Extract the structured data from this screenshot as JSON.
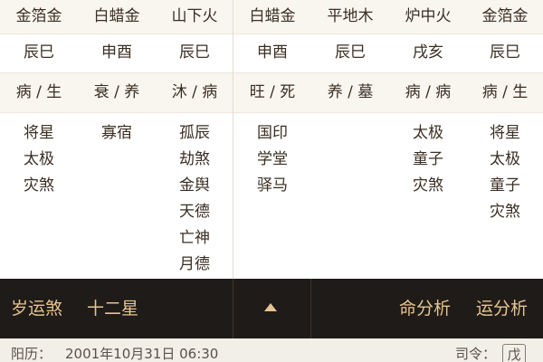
{
  "columns": [
    {
      "nayin": "金箔金",
      "kongwang": "辰巳",
      "state": "病 / 生",
      "stars": [
        "将星",
        "太极",
        "灾煞"
      ]
    },
    {
      "nayin": "白蜡金",
      "kongwang": "申酉",
      "state": "衰 / 养",
      "stars": [
        "寡宿"
      ]
    },
    {
      "nayin": "山下火",
      "kongwang": "辰巳",
      "state": "沐 / 病",
      "stars": [
        "孤辰",
        "劫煞",
        "金舆",
        "天德",
        "亡神",
        "月德"
      ]
    },
    {
      "nayin": "白蜡金",
      "kongwang": "申酉",
      "state": "旺 / 死",
      "stars": [
        "国印",
        "学堂",
        "驿马"
      ]
    },
    {
      "nayin": "平地木",
      "kongwang": "辰巳",
      "state": "养 / 墓",
      "stars": []
    },
    {
      "nayin": "炉中火",
      "kongwang": "戌亥",
      "state": "病 / 病",
      "stars": [
        "太极",
        "童子",
        "灾煞"
      ]
    },
    {
      "nayin": "金箔金",
      "kongwang": "辰巳",
      "state": "病 / 生",
      "stars": [
        "将星",
        "太极",
        "童子",
        "灾煞"
      ]
    }
  ],
  "toolbar": {
    "suiyun_label": "岁运煞",
    "twelve_stars_label": "十二星",
    "ming_analysis_label": "命分析",
    "yun_analysis_label": "运分析"
  },
  "footer": {
    "solar_label": "阳历：",
    "solar_date": "2001年10月31日 06:30",
    "siling_label": "司令：",
    "siling_value": "戊"
  },
  "colors": {
    "accent": "#e6c491",
    "toolbar_bg": "#1f1b18",
    "row_alt_bg": "#f9f6f0"
  }
}
